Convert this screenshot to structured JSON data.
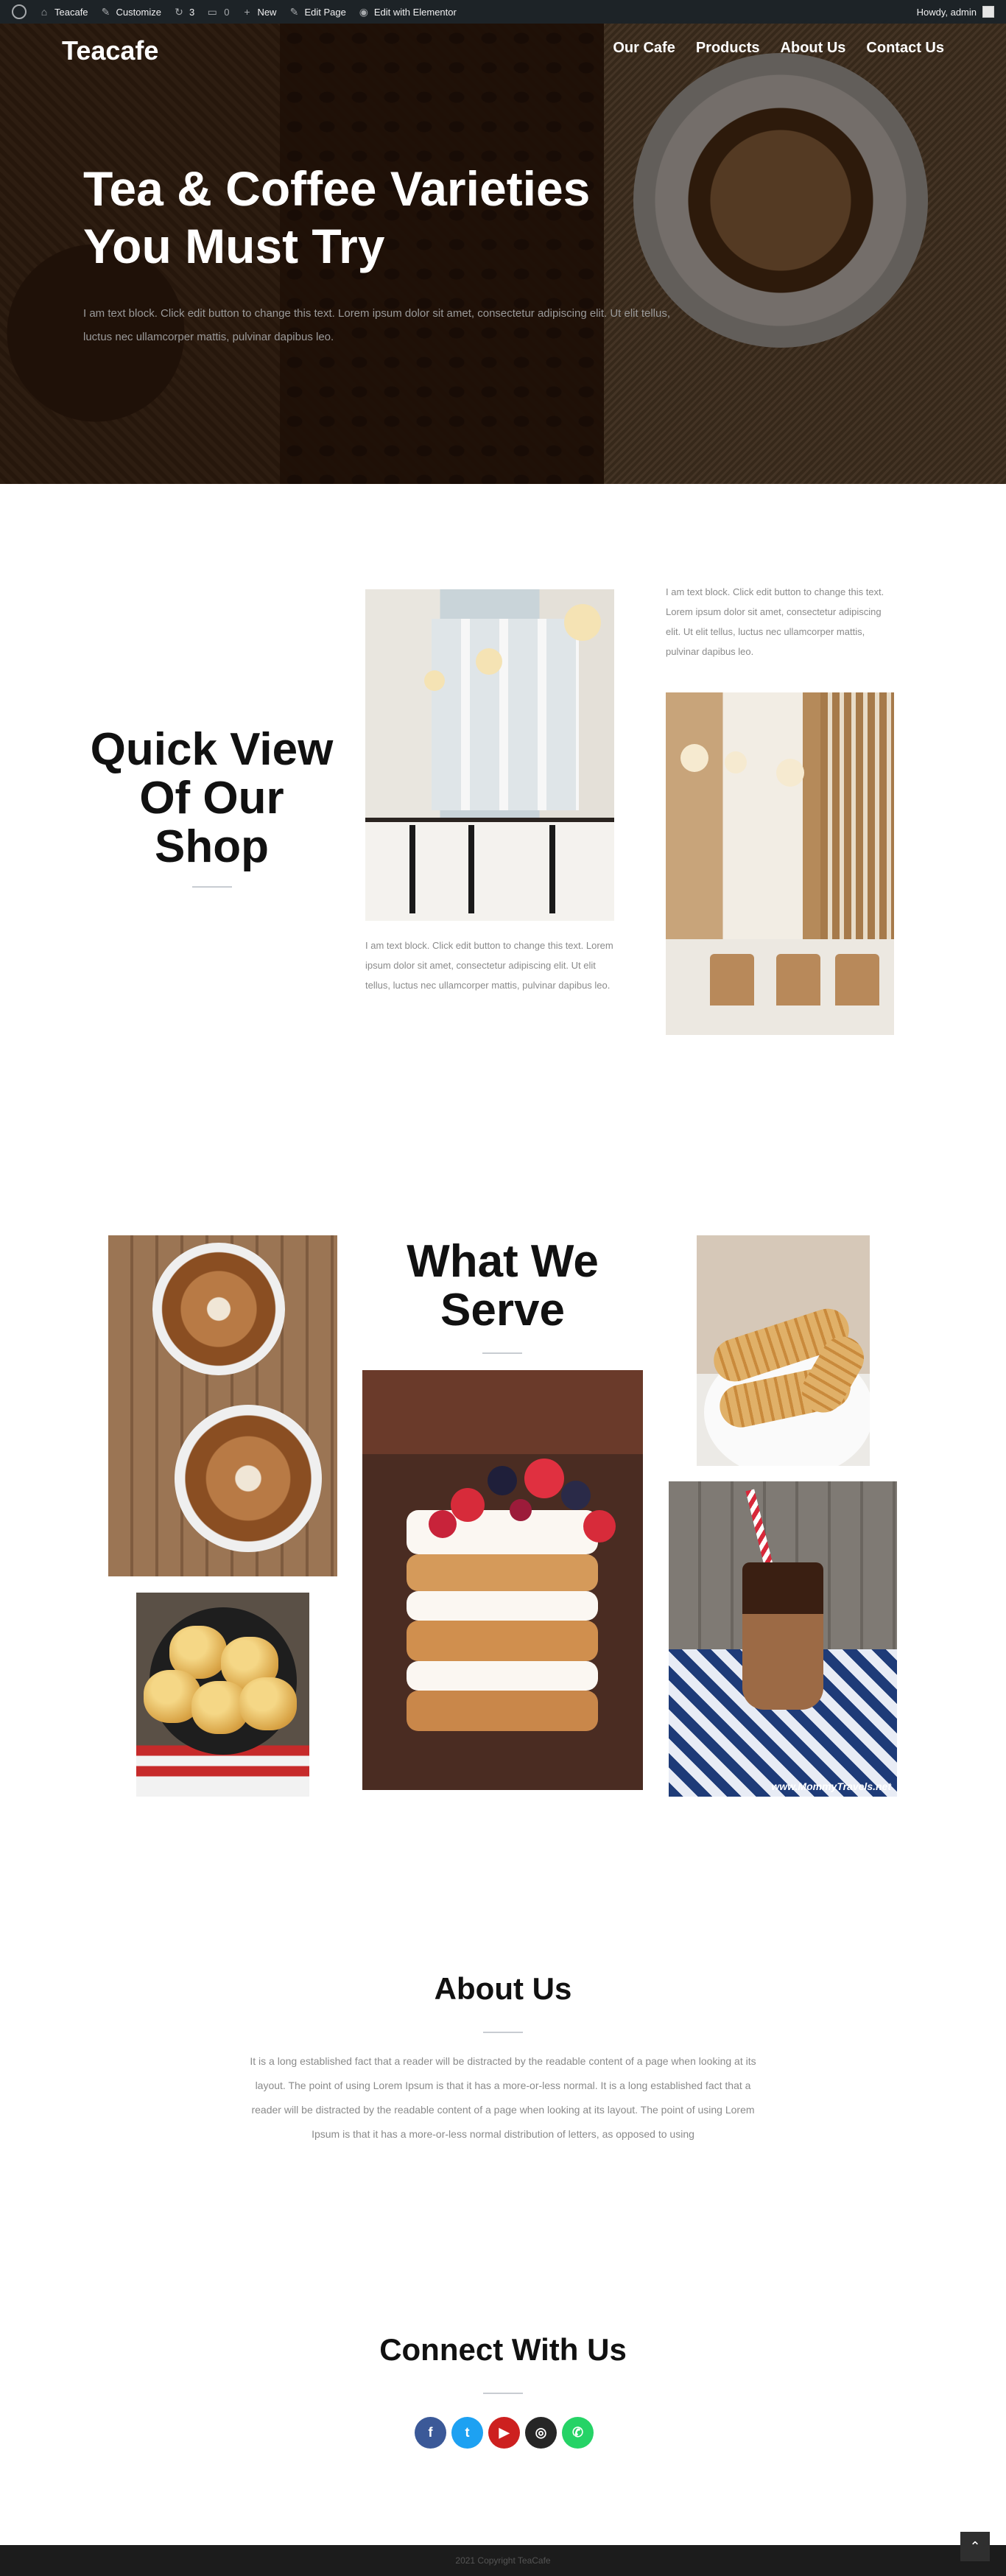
{
  "adminbar": {
    "site_name": "Teacafe",
    "customize": "Customize",
    "updates_count": "3",
    "comments_count": "0",
    "new": "New",
    "edit_page": "Edit Page",
    "edit_elementor": "Edit with Elementor",
    "howdy": "Howdy, admin"
  },
  "header": {
    "logo": "Teacafe",
    "nav": [
      "Our Cafe",
      "Products",
      "About Us",
      "Contact Us"
    ]
  },
  "hero": {
    "title": "Tea & Coffee Varieties You Must Try",
    "text": "I am text block. Click edit button to change this text. Lorem ipsum dolor sit amet, consectetur adipiscing elit. Ut elit tellus, luctus nec ullamcorper mattis, pulvinar dapibus leo."
  },
  "quick_view": {
    "title": "Quick View Of Our Shop",
    "text1": "I am text block. Click edit button to change this text. Lorem ipsum dolor sit amet, consectetur adipiscing elit. Ut elit tellus, luctus nec ullamcorper mattis, pulvinar dapibus leo.",
    "text2": "I am text block. Click edit button to change this text. Lorem ipsum dolor sit amet, consectetur adipiscing elit. Ut elit tellus, luctus nec ullamcorper mattis, pulvinar dapibus leo."
  },
  "what_we_serve": {
    "title": "What We Serve",
    "shake_watermark": "www.MommyTravels.net"
  },
  "about": {
    "title": "About Us",
    "text": "It is a long established fact that a reader will be distracted by the readable content of a page when looking at its layout. The point of using Lorem Ipsum is that it has a more-or-less normal. It is a long established fact that a reader will be distracted by the readable content of a page when looking at its layout. The point of using Lorem Ipsum is that it has a more-or-less normal distribution of letters, as opposed to using"
  },
  "connect": {
    "title": "Connect With Us",
    "icons": [
      {
        "name": "facebook-icon",
        "glyph": "f",
        "color": "#3b5998"
      },
      {
        "name": "twitter-icon",
        "glyph": "t",
        "color": "#1da1f2"
      },
      {
        "name": "youtube-icon",
        "glyph": "▶",
        "color": "#cd201f"
      },
      {
        "name": "instagram-icon",
        "glyph": "◎",
        "color": "#262626"
      },
      {
        "name": "whatsapp-icon",
        "glyph": "✆",
        "color": "#25d366"
      }
    ]
  },
  "footer": {
    "copyright": "2021 Copyright TeaCafe",
    "to_top": "⌃"
  }
}
